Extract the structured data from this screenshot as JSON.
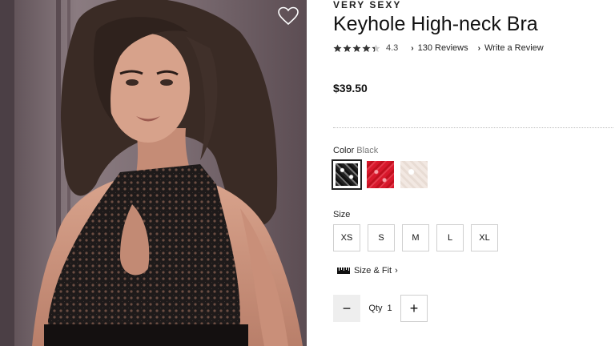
{
  "product": {
    "brand": "VERY SEXY",
    "title": "Keyhole High-neck Bra",
    "rating_value": "4.3",
    "rating_stars": 4.3,
    "reviews_link": "130 Reviews",
    "write_review_link": "Write a Review",
    "price": "$39.50"
  },
  "color": {
    "label": "Color",
    "selected": "Black",
    "swatches": [
      {
        "name": "black-lace",
        "hex": "#222222"
      },
      {
        "name": "red-lace",
        "hex": "#d8182c"
      },
      {
        "name": "ivory-lace",
        "hex": "#efe4de"
      }
    ]
  },
  "size": {
    "label": "Size",
    "options": [
      "XS",
      "S",
      "M",
      "L",
      "XL"
    ]
  },
  "fit": {
    "label": "Size & Fit",
    "icon": "ruler-icon"
  },
  "quantity": {
    "label": "Qty",
    "value": "1",
    "minus_symbol": "−",
    "plus_symbol": "+"
  },
  "icons": {
    "favorite": "heart-outline-icon",
    "star": "star-icon",
    "chevron": "chevron-right-icon"
  }
}
